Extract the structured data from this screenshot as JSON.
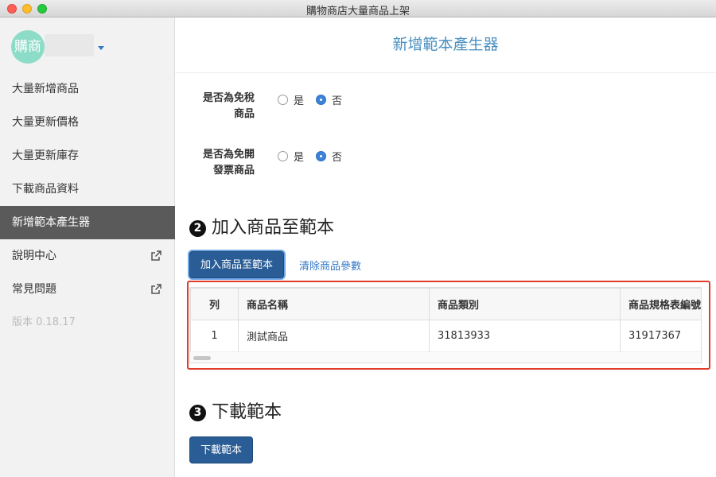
{
  "window": {
    "title": "購物商店大量商品上架"
  },
  "sidebar": {
    "avatar_text": "購商",
    "items": [
      {
        "label": "大量新增商品"
      },
      {
        "label": "大量更新價格"
      },
      {
        "label": "大量更新庫存"
      },
      {
        "label": "下載商品資料"
      },
      {
        "label": "新增範本產生器",
        "active": true
      },
      {
        "label": "說明中心",
        "icon": "external-link-icon"
      },
      {
        "label": "常見問題",
        "icon": "external-link-icon"
      }
    ],
    "version": "版本 0.18.17"
  },
  "main": {
    "header": "新增範本產生器",
    "fields": [
      {
        "label_line1": "是否為免稅",
        "label_line2": "商品",
        "option_yes": "是",
        "option_no": "否",
        "selected": "否"
      },
      {
        "label_line1": "是否為免開",
        "label_line2": "發票商品",
        "option_yes": "是",
        "option_no": "否",
        "selected": "否"
      }
    ],
    "section2": {
      "number": "2",
      "title": "加入商品至範本",
      "add_button": "加入商品至範本",
      "clear_link": "清除商品參數"
    },
    "table": {
      "headers": [
        "列",
        "商品名稱",
        "商品類別",
        "商品規格表編號"
      ],
      "rows": [
        [
          "1",
          "測試商品",
          "31813933",
          "31917367"
        ]
      ]
    },
    "section3": {
      "number": "3",
      "title": "下載範本",
      "download_button": "下載範本"
    }
  },
  "colors": {
    "accent": "#4a90c2",
    "button": "#2a5d96",
    "highlight": "#e03b2b",
    "sidebar_active": "#5a5a5a"
  }
}
